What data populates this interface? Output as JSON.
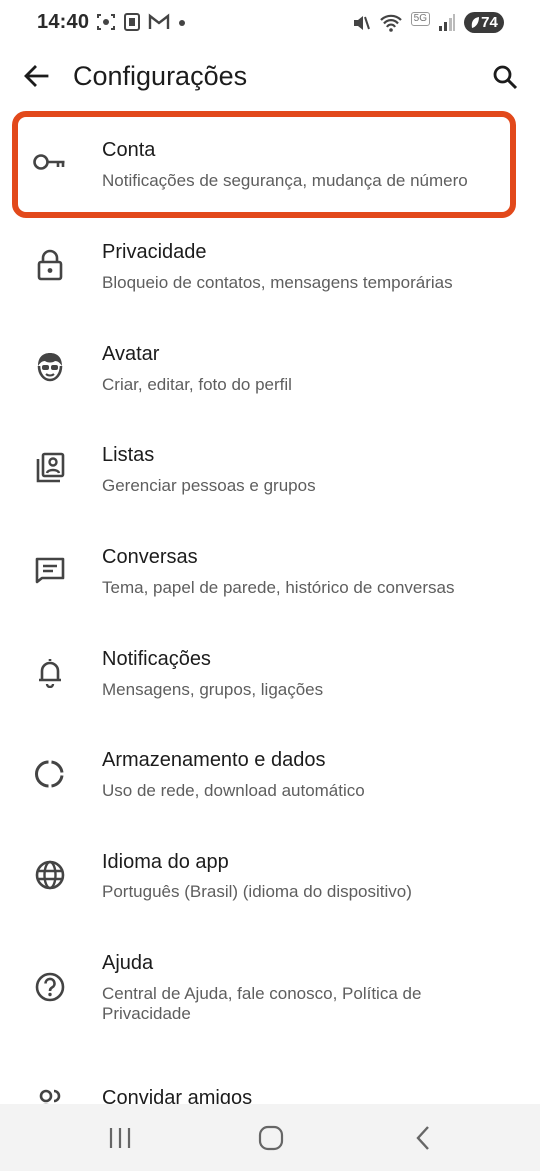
{
  "status_bar": {
    "time": "14:40",
    "battery": "74",
    "network": "5G"
  },
  "header": {
    "title": "Configurações"
  },
  "settings": [
    {
      "title": "Conta",
      "subtitle": "Notificações de segurança, mudança de número",
      "icon": "key-icon"
    },
    {
      "title": "Privacidade",
      "subtitle": "Bloqueio de contatos, mensagens temporárias",
      "icon": "lock-icon"
    },
    {
      "title": "Avatar",
      "subtitle": "Criar, editar, foto do perfil",
      "icon": "avatar-face-icon"
    },
    {
      "title": "Listas",
      "subtitle": "Gerenciar pessoas e grupos",
      "icon": "contacts-list-icon"
    },
    {
      "title": "Conversas",
      "subtitle": "Tema, papel de parede, histórico de conversas",
      "icon": "chat-icon"
    },
    {
      "title": "Notificações",
      "subtitle": "Mensagens, grupos, ligações",
      "icon": "bell-icon"
    },
    {
      "title": "Armazenamento e dados",
      "subtitle": "Uso de rede, download automático",
      "icon": "storage-circle-icon"
    },
    {
      "title": "Idioma do app",
      "subtitle": "Português (Brasil) (idioma do dispositivo)",
      "icon": "globe-icon"
    },
    {
      "title": "Ajuda",
      "subtitle": "Central de Ajuda, fale conosco, Política de Privacidade",
      "icon": "help-circle-icon"
    },
    {
      "title": "Convidar amigos",
      "subtitle": "",
      "icon": "people-icon"
    }
  ],
  "colors": {
    "highlight": "#e2491b",
    "icon": "#444444",
    "subtitle": "#5e5e5e"
  }
}
